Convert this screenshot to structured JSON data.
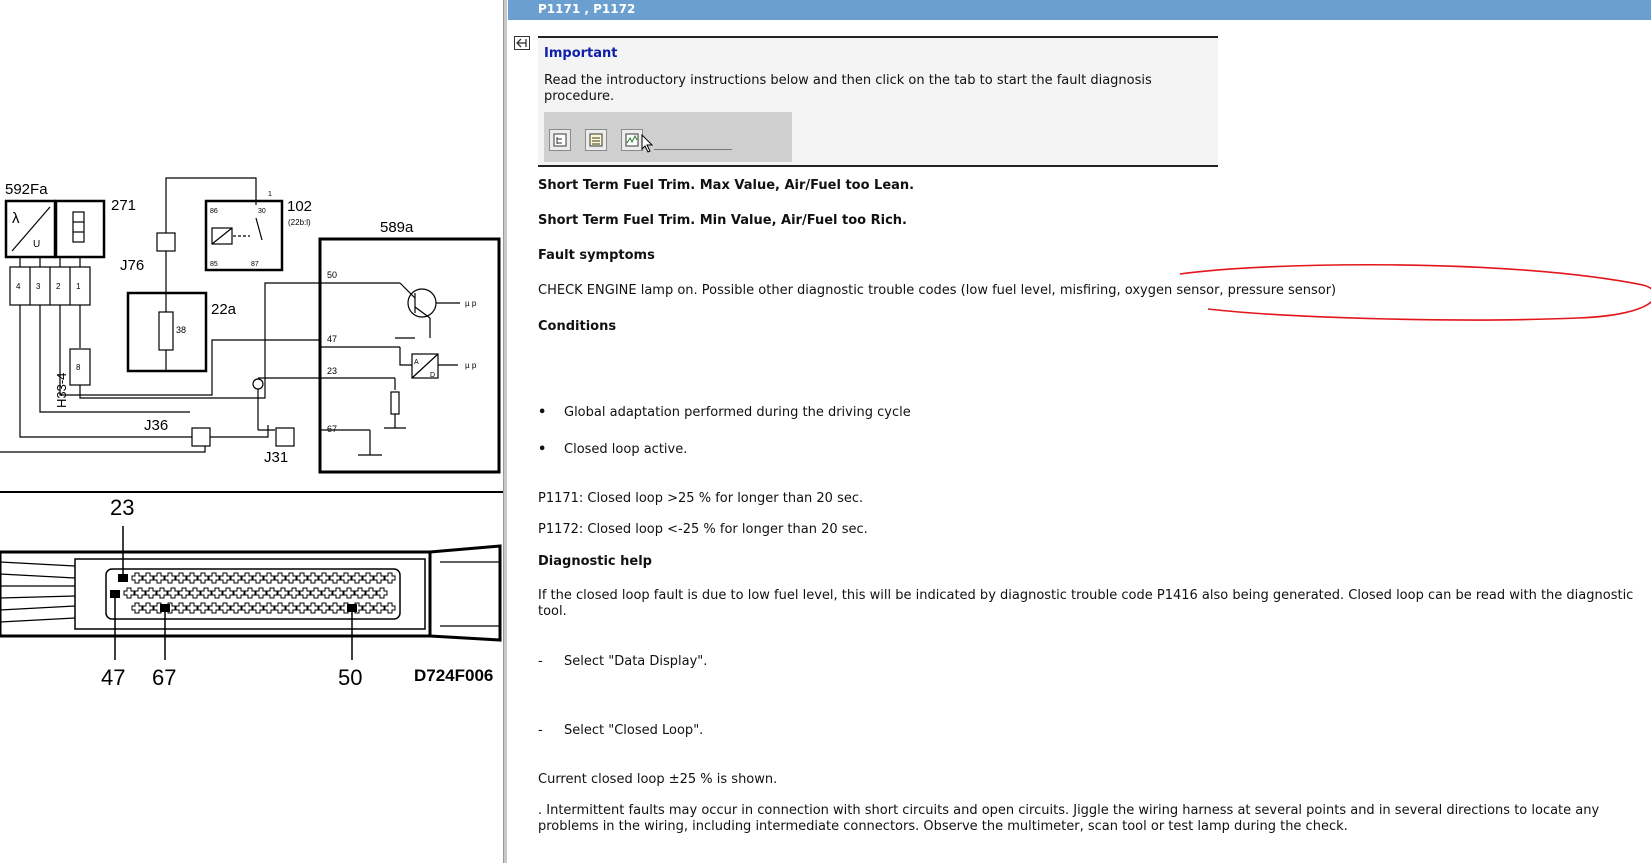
{
  "diagram": {
    "labels": {
      "l592fa": "592Fa",
      "l271": "271",
      "l102": "102",
      "l102sub": "(22b:l)",
      "l589a": "589a",
      "j76": "J76",
      "l22a": "22a",
      "h334": "H33-4",
      "j36": "J36",
      "j31": "J31",
      "pin50": "50",
      "pin47": "47",
      "pin23": "23",
      "pin67": "67",
      "r38": "38",
      "up1": "µ p",
      "up2": "µ p",
      "lambda": "λ",
      "uvar": "U",
      "c4": "4",
      "c3": "3",
      "c2": "2",
      "c1": "1",
      "c8": "8",
      "rel86": "86",
      "rel30": "30",
      "rel85": "85",
      "rel87": "87",
      "rel1": "1",
      "adA": "A",
      "adD": "D"
    },
    "connector": {
      "top_label": "23",
      "bottom_labels": [
        "47",
        "67",
        "50"
      ],
      "code": "D724F006"
    }
  },
  "header": {
    "title": "P1171 , P1172"
  },
  "important": {
    "title": "Important",
    "text": "Read the introductory instructions below and then click on the tab to start the fault diagnosis procedure."
  },
  "content": {
    "heading_lean": "Short Term Fuel Trim. Max Value, Air/Fuel too Lean.",
    "heading_rich": "Short Term Fuel Trim. Min Value, Air/Fuel too Rich.",
    "fault_symptoms_heading": "Fault symptoms",
    "fault_symptoms_text": "CHECK ENGINE lamp on. Possible other diagnostic trouble codes (low fuel level, misfiring, oxygen sensor, pressure sensor)",
    "conditions_heading": "Conditions",
    "bullets": [
      "Global adaptation performed during the driving cycle",
      "Closed loop active."
    ],
    "bullet_marker": "•",
    "p1171": "P1171: Closed loop >25 % for longer than 20 sec.",
    "p1172": "P1172: Closed loop <-25 % for longer than 20 sec.",
    "diag_help_heading": "Diagnostic help",
    "diag_help_text": "If the closed loop fault is due to low fuel level, this will be indicated by diagnostic trouble code P1416 also being generated. Closed loop can be read with the diagnostic tool.",
    "step_marker": "-",
    "step1": "Select \"Data Display\".",
    "step2": "Select \"Closed Loop\".",
    "current": "Current closed loop ±25 % is shown.",
    "intermittent": ". Intermittent faults may occur in connection with short circuits and open circuits. Jiggle the wiring harness at several points and in several directions to locate any problems in the wiring, including intermediate connectors. Observe the multimeter, scan tool or test lamp during the check."
  },
  "colors": {
    "header_bar": "#6a9fd0",
    "important_title": "#0f1fa8",
    "annotation": "#e3161b"
  },
  "icons": [
    "back-arrow-icon",
    "tree-tab-icon",
    "list-tab-icon",
    "graph-tab-icon",
    "mouse-cursor-icon"
  ]
}
